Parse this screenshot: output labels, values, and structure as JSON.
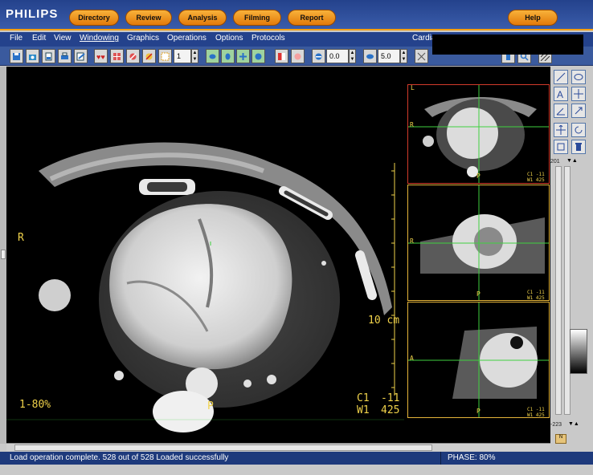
{
  "brand": "PHILIPS",
  "nav": [
    "Directory",
    "Review",
    "Analysis",
    "Filming",
    "Report",
    "Help"
  ],
  "menu": [
    "File",
    "Edit",
    "View",
    "Windowing",
    "Graphics",
    "Operations",
    "Options",
    "Protocols"
  ],
  "patient_label": "Cardia",
  "toolbar": {
    "frame_value": "1",
    "zoom_value": "0.0",
    "thickness_value": "5.0"
  },
  "main_view": {
    "left_marker": "R",
    "bottom_marker": "P",
    "phase_label": "1-80%",
    "scale_label": "10 cm",
    "window_center_label": "C1",
    "window_center_value": "-11",
    "window_width_label": "W1",
    "window_width_value": "425"
  },
  "side_views": [
    {
      "top_marker": "L",
      "left_marker": "R",
      "bottom_marker": "P",
      "c_label": "C1",
      "c_value": "-11",
      "w_label": "W1",
      "w_value": "425"
    },
    {
      "top_marker": "",
      "left_marker": "R",
      "bottom_marker": "P",
      "c_label": "C1",
      "c_value": "-11",
      "w_label": "W1",
      "w_value": "425"
    },
    {
      "top_marker": "",
      "left_marker": "A",
      "bottom_marker": "P",
      "c_label": "C1",
      "c_value": "-11",
      "w_label": "W1",
      "w_value": "425"
    }
  ],
  "palette": {
    "scroll_top": "201",
    "scroll_bottom": "-223"
  },
  "status": {
    "message": "Load operation complete. 528 out of 528 Loaded successfully",
    "phase": "PHASE: 80%"
  },
  "colors": {
    "nav_band": "#24428c",
    "nav_button": "#f0901c",
    "overlay_text": "#f0d24a",
    "crosshair": "#3fd13f",
    "panel_border_active": "#d23b2b",
    "panel_border": "#e6b53a"
  }
}
